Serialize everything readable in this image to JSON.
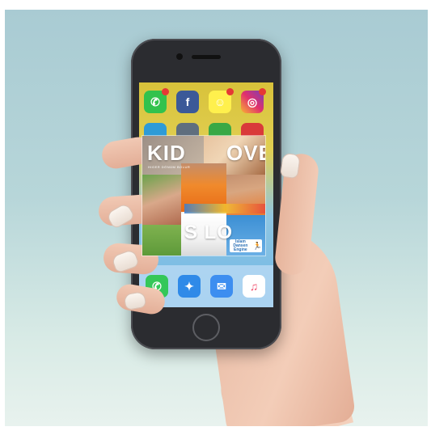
{
  "collage": {
    "headline_left": "KID",
    "headline_right": "OVE",
    "subtitle": "HIGER DÖNÜM BOLUR",
    "bottom_text": "S LO",
    "logo_text": "Islam Dansen Engine",
    "logo_icon": "running-figure-icon"
  },
  "apps_row1": [
    "whatsapp-icon",
    "facebook-icon",
    "snapchat-icon",
    "instagram-icon"
  ],
  "dock_apps": [
    "phone-icon",
    "safari-icon",
    "mail-icon",
    "music-icon"
  ],
  "colors": {
    "background_top": "#a9cbd3",
    "background_bottom": "#e8f2ee",
    "phone_body": "#2b2c30",
    "screen_top": "#d8c23a",
    "screen_bottom": "#6fb6e4"
  }
}
